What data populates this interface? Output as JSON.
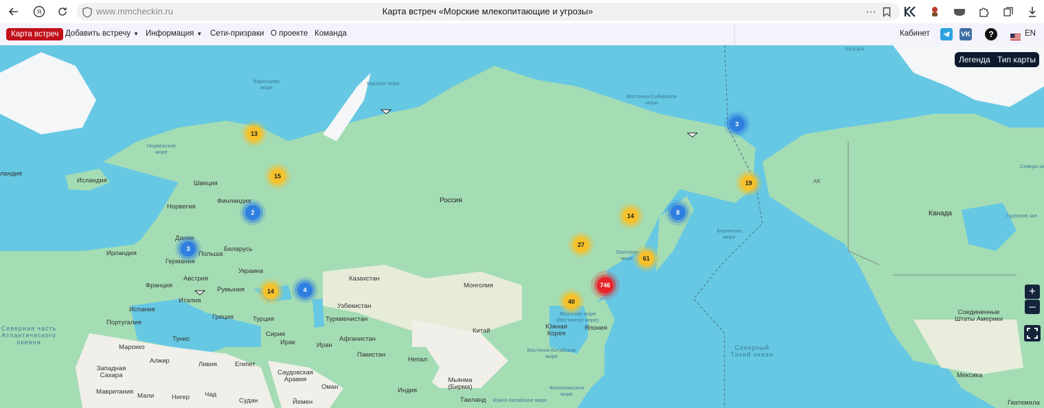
{
  "browser": {
    "url": "www.mmcheckin.ru",
    "page_title": "Карта встреч «Морские млекопитающие и угрозы»"
  },
  "nav": {
    "active": "Карта встреч",
    "items": [
      "Добавить встречу",
      "Информация",
      "Сети-призраки",
      "О проекте",
      "Команда"
    ],
    "cabinet": "Кабинет",
    "lang": "EN"
  },
  "map": {
    "legend_btn": "Легенда",
    "maptype_btn": "Тип карты",
    "zoom_in": "+",
    "zoom_out": "–",
    "labels": {
      "russia": "Россия",
      "kazakhstan": "Казахстан",
      "mongolia": "Монголия",
      "china": "Китай",
      "canada": "Канада",
      "usa": "Соединенные Штаты Америки",
      "mexico": "Мексика",
      "norway": "Норвегия",
      "sweden": "Швеция",
      "finland": "Финляндия",
      "iceland": "Исландия",
      "iceland_edge": "ландия",
      "ireland": "Ирландия",
      "denmark": "Дания",
      "germany": "Германия",
      "poland": "Польша",
      "belarus": "Беларусь",
      "ukraine": "Украина",
      "france": "Франция",
      "austria": "Австрия",
      "italy": "Италия",
      "romania": "Румыния",
      "spain": "Испания",
      "portugal": "Португалия",
      "greece": "Греция",
      "turkey": "Турция",
      "syria": "Сирия",
      "iraq": "Ирак",
      "iran": "Иран",
      "uzbekistan": "Узбекистан",
      "turkmenistan": "Туркменистан",
      "afghanistan": "Афганистан",
      "pakistan": "Пакистан",
      "nepal": "Непал",
      "india": "Индия",
      "myanmar": "Мьянма (Бирма)",
      "thailand": "Таиланд",
      "korea": "Южная Корея",
      "japan": "Япония",
      "tunis": "Тунис",
      "morocco": "Марокко",
      "algeria": "Алжир",
      "libya": "Ливия",
      "egypt": "Египет",
      "saudi": "Саудовская Аравия",
      "oman": "Оман",
      "yemen": "Йемен",
      "sudan": "Судан",
      "mali": "Мали",
      "niger": "Нигер",
      "chad": "Чад",
      "mauritania": "Мавритания",
      "w_sahara": "Западная Сахара",
      "guatemala": "Гватемала",
      "ak": "AK"
    },
    "seas": {
      "barents": "Баренцево море",
      "kara": "Карское море",
      "e_sib": "Восточно-Сибирское море",
      "norwegian": "Норвежское море",
      "okhotsk": "Охотское море",
      "bering": "Берингово море",
      "japan_sea": "Японское море (Восточное море)",
      "e_china": "Восточно-Китайское море",
      "s_china": "Южно-Китайское море",
      "philippine": "Филиппинское море",
      "n_pacific": "Северный Тихий океан",
      "n_atlantic": "Северная часть Атлантического океана",
      "hudson": "Гудзонов зал",
      "beaufort": "Бофорта",
      "ocean_top": "океан",
      "greenland": "Гренландия",
      "north_sea": "Северо-за"
    },
    "clusters": [
      {
        "count": "13",
        "color": "yellow"
      },
      {
        "count": "15",
        "color": "yellow"
      },
      {
        "count": "2",
        "color": "blue"
      },
      {
        "count": "3",
        "color": "blue"
      },
      {
        "count": "14",
        "color": "yellow"
      },
      {
        "count": "4",
        "color": "blue"
      },
      {
        "count": "27",
        "color": "yellow"
      },
      {
        "count": "14",
        "color": "yellow"
      },
      {
        "count": "8",
        "color": "blue"
      },
      {
        "count": "61",
        "color": "yellow"
      },
      {
        "count": "746",
        "color": "red"
      },
      {
        "count": "40",
        "color": "yellow"
      },
      {
        "count": "19",
        "color": "yellow"
      },
      {
        "count": "3",
        "color": "blue"
      }
    ]
  },
  "colors": {
    "water": "#66c8e3",
    "land": "#a4dcb4",
    "desert": "#f0efe9",
    "ice": "#f4f6f7",
    "accent": "#c0101a"
  }
}
